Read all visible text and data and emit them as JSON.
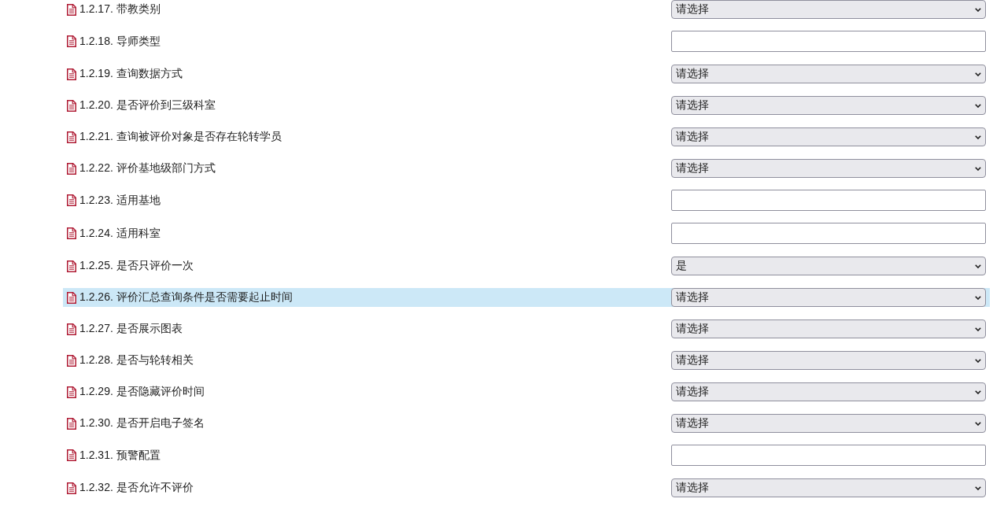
{
  "items": [
    {
      "number": "1.2.17.",
      "title": "带教类别",
      "selected": false,
      "control": {
        "kind": "select",
        "value": "请选择"
      }
    },
    {
      "number": "1.2.18.",
      "title": "导师类型",
      "selected": false,
      "control": {
        "kind": "input"
      }
    },
    {
      "number": "1.2.19.",
      "title": "查询数据方式",
      "selected": false,
      "control": {
        "kind": "select",
        "value": "请选择"
      }
    },
    {
      "number": "1.2.20.",
      "title": "是否评价到三级科室",
      "selected": false,
      "control": {
        "kind": "select",
        "value": "请选择"
      }
    },
    {
      "number": "1.2.21.",
      "title": "查询被评价对象是否存在轮转学员",
      "selected": false,
      "control": {
        "kind": "select",
        "value": "请选择"
      }
    },
    {
      "number": "1.2.22.",
      "title": "评价基地级部门方式",
      "selected": false,
      "control": {
        "kind": "select",
        "value": "请选择"
      }
    },
    {
      "number": "1.2.23.",
      "title": "适用基地",
      "selected": false,
      "control": {
        "kind": "input"
      }
    },
    {
      "number": "1.2.24.",
      "title": "适用科室",
      "selected": false,
      "control": {
        "kind": "input"
      }
    },
    {
      "number": "1.2.25.",
      "title": "是否只评价一次",
      "selected": false,
      "control": {
        "kind": "select",
        "value": "是"
      }
    },
    {
      "number": "1.2.26.",
      "title": "评价汇总查询条件是否需要起止时间",
      "selected": true,
      "control": {
        "kind": "select",
        "value": "请选择"
      }
    },
    {
      "number": "1.2.27.",
      "title": "是否展示图表",
      "selected": false,
      "control": {
        "kind": "select",
        "value": "请选择"
      }
    },
    {
      "number": "1.2.28.",
      "title": "是否与轮转相关",
      "selected": false,
      "control": {
        "kind": "select",
        "value": "请选择"
      }
    },
    {
      "number": "1.2.29.",
      "title": "是否隐藏评价时间",
      "selected": false,
      "control": {
        "kind": "select",
        "value": "请选择"
      }
    },
    {
      "number": "1.2.30.",
      "title": "是否开启电子签名",
      "selected": false,
      "control": {
        "kind": "select",
        "value": "请选择"
      }
    },
    {
      "number": "1.2.31.",
      "title": "预警配置",
      "selected": false,
      "control": {
        "kind": "input"
      }
    },
    {
      "number": "1.2.32.",
      "title": "是否允许不评价",
      "selected": false,
      "control": {
        "kind": "select",
        "value": "请选择"
      }
    }
  ]
}
